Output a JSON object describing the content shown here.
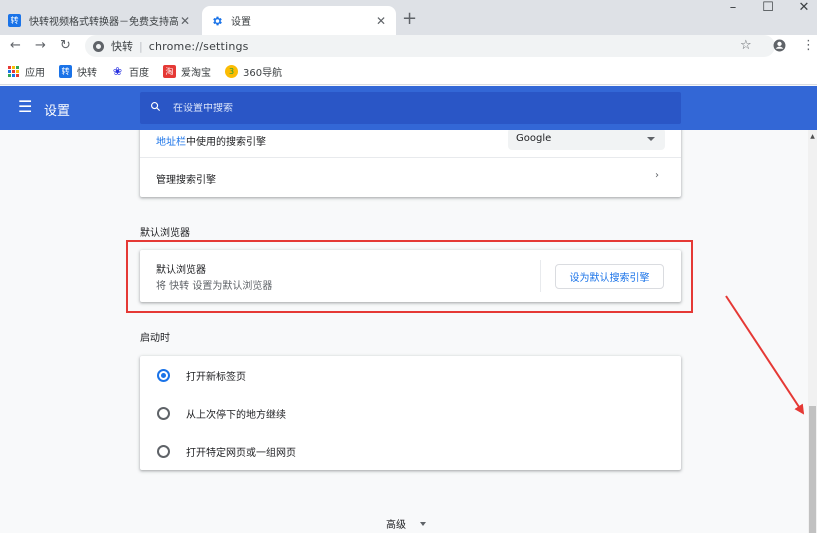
{
  "tabs": [
    {
      "title": "快转视频格式转换器－免费支持高",
      "favicon_text": "转",
      "favicon_color": "#1a73e8",
      "active": false
    },
    {
      "title": "设置",
      "favicon_icon": "gear-icon",
      "favicon_color": "#1a73e8",
      "active": true
    }
  ],
  "window_controls": {
    "minimize": "–",
    "maximize": "☐",
    "close": "✕"
  },
  "toolbar": {
    "site_chip": "快转",
    "url": "chrome://settings"
  },
  "bookmarks": [
    {
      "label": "应用",
      "icon": "apps-grid-icon"
    },
    {
      "label": "快转",
      "icon": "kuaizhuan-icon",
      "icon_text": "转",
      "color": "#1a73e8"
    },
    {
      "label": "百度",
      "icon": "baidu-paw-icon",
      "icon_text": "❀",
      "color": "#2932e1"
    },
    {
      "label": "爱淘宝",
      "icon": "taobao-icon",
      "icon_text": "淘",
      "color": "#e53935"
    },
    {
      "label": "360导航",
      "icon": "nav360-icon",
      "icon_text": "3",
      "color": "#22a137"
    }
  ],
  "header": {
    "title": "设置",
    "search_placeholder": "在设置中搜索"
  },
  "search_engine": {
    "address_bar_label": "地址栏中使用的搜索引擎",
    "address_bar_label_link_part": "地址栏",
    "address_bar_label_rest": "中使用的搜索引擎",
    "engine_value": "Google",
    "manage_label": "管理搜索引擎"
  },
  "default_browser": {
    "section_title": "默认浏览器",
    "row_title": "默认浏览器",
    "row_subtitle": "将 快转 设置为默认浏览器",
    "button_label": "设为默认搜索引擎"
  },
  "startup": {
    "section_title": "启动时",
    "options": [
      {
        "label": "打开新标签页",
        "checked": true
      },
      {
        "label": "从上次停下的地方继续",
        "checked": false
      },
      {
        "label": "打开特定网页或一组网页",
        "checked": false
      }
    ]
  },
  "advanced_label": "高级",
  "colors": {
    "header_blue": "#3367d6",
    "accent_blue": "#1a73e8",
    "annotation_red": "#e53935"
  }
}
